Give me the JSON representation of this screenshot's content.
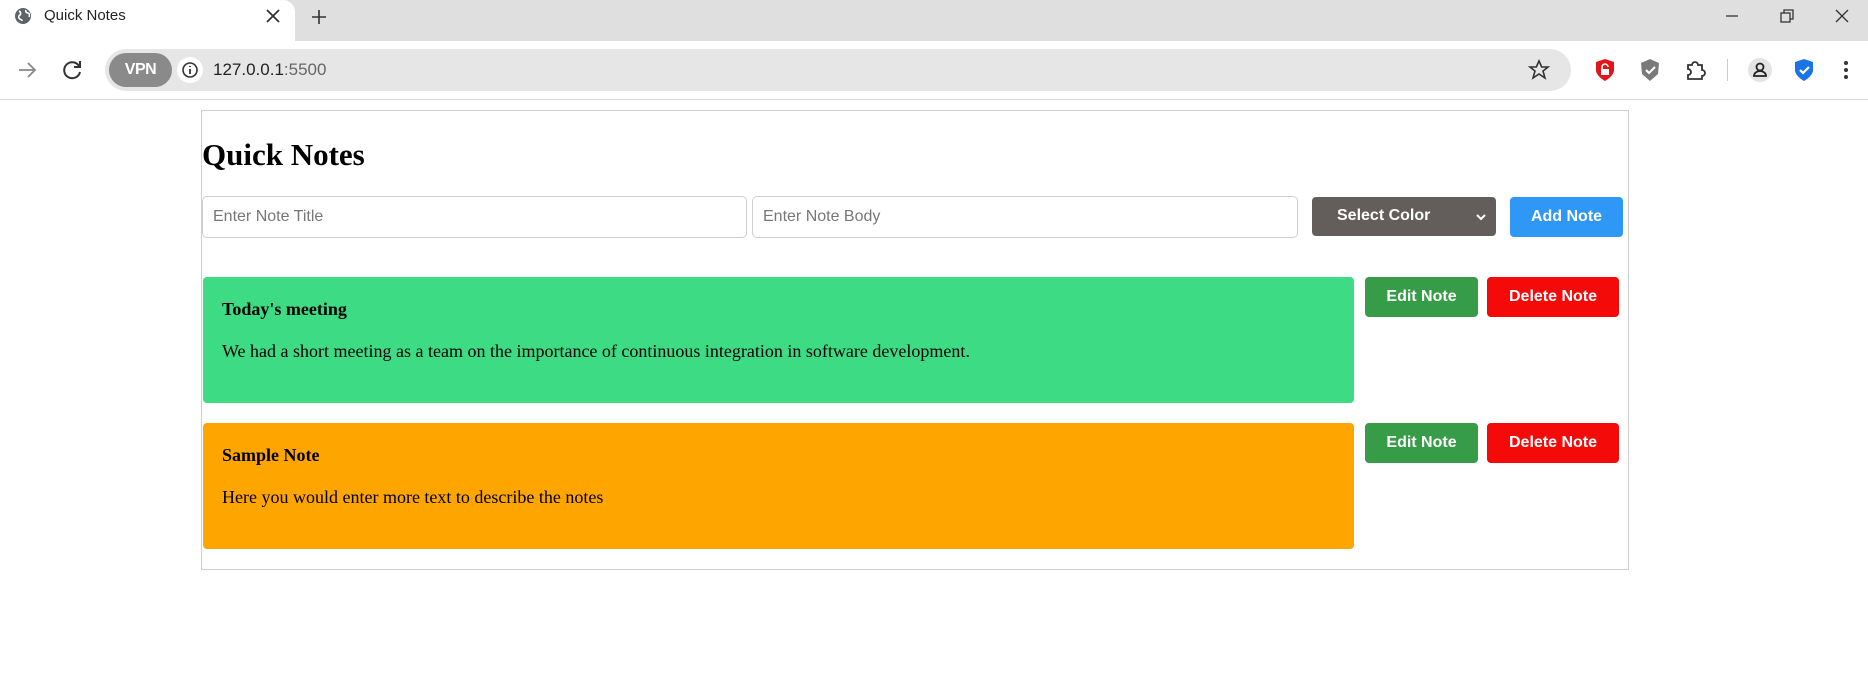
{
  "browser": {
    "tab_title": "Quick Notes",
    "vpn_label": "VPN",
    "url_host": "127.0.0.1",
    "url_port": ":5500"
  },
  "app": {
    "title": "Quick Notes",
    "title_placeholder": "Enter Note Title",
    "body_placeholder": "Enter Note Body",
    "select_label": "Select Color",
    "add_label": "Add Note",
    "notes": [
      {
        "title": "Today's meeting",
        "body": "We had a short meeting as a team on the importance of continuous integration in software development.",
        "color": "#3ddc84",
        "edit_label": "Edit Note",
        "delete_label": "Delete Note"
      },
      {
        "title": "Sample Note",
        "body": "Here you would enter more text to describe the notes",
        "color": "#ffa500",
        "edit_label": "Edit Note",
        "delete_label": "Delete Note"
      }
    ]
  },
  "colors": {
    "select_bg": "#635e5b",
    "add_button": "#2f98f7",
    "edit_button": "#369c47",
    "delete_button": "#f50a0a"
  }
}
